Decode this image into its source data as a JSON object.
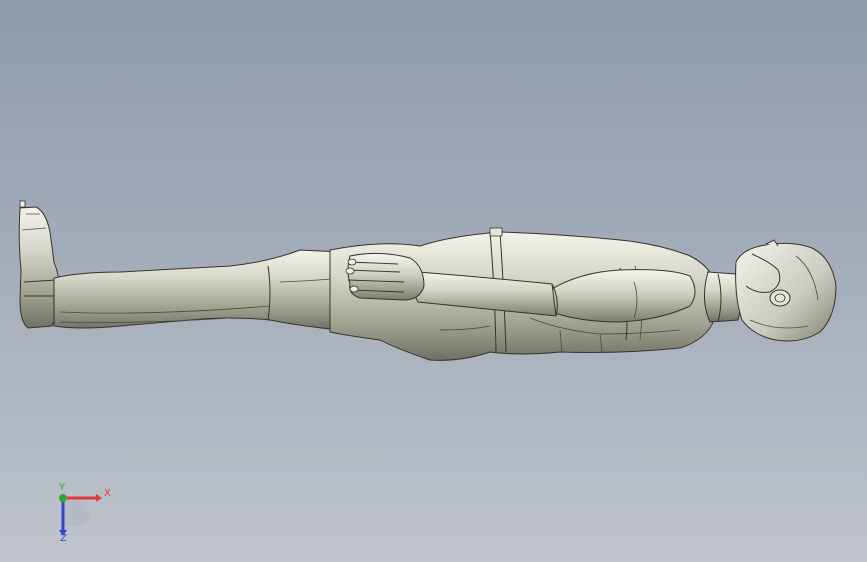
{
  "viewport": {
    "background_top": "#8f9aab",
    "background_bottom": "#bfc4cd",
    "model_color": "#d2d3c6"
  },
  "triad": {
    "x_label": "X",
    "y_label": "Y",
    "z_label": "Z",
    "x_color": "#e23a3a",
    "y_color": "#2fa82f",
    "z_color": "#3446c8"
  }
}
